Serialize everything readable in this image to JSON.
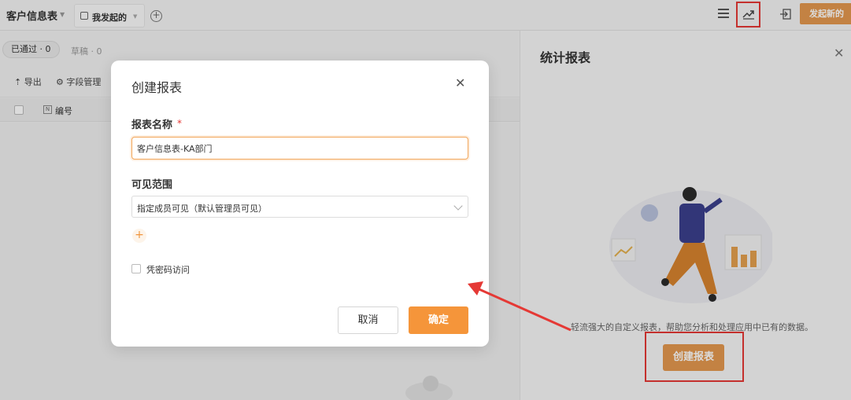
{
  "topbar": {
    "app_title": "客户信息表",
    "tab_label": "我发起的",
    "launch_label": "发起新的",
    "icons": {
      "list": "list-icon",
      "trend": "trend-chart-icon",
      "exit": "exit-icon",
      "add": "add-circle-icon"
    }
  },
  "status_tabs": {
    "passed": "已通过 · 0",
    "draft": "草稿 · 0"
  },
  "toolbar": {
    "export": "导出",
    "field_manage": "字段管理"
  },
  "table": {
    "column_number": "编号"
  },
  "panel": {
    "title": "统计报表",
    "description": "轻流强大的自定义报表，帮助您分析和处理应用中已有的数据。",
    "create_label": "创建报表"
  },
  "modal": {
    "title": "创建报表",
    "name_label": "报表名称",
    "required_mark": "*",
    "name_value": "客户信息表-KA部门",
    "scope_label": "可见范围",
    "scope_value": "指定成员可见（默认管理员可见）",
    "add_symbol": "+",
    "password_label": "凭密码访问",
    "cancel_label": "取消",
    "confirm_label": "确定"
  },
  "colors": {
    "accent": "#F5953A",
    "brand_button": "#E3984E",
    "annotation_red": "#E53935"
  }
}
